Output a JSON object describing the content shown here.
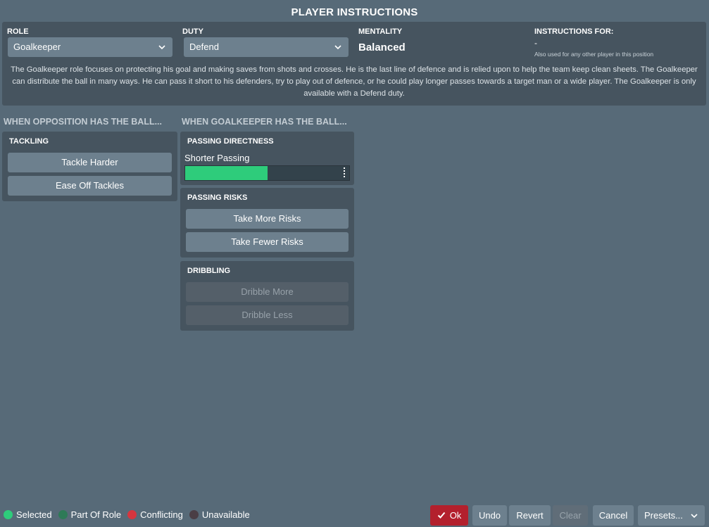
{
  "title": "PLAYER INSTRUCTIONS",
  "role": {
    "label": "ROLE",
    "value": "Goalkeeper"
  },
  "duty": {
    "label": "DUTY",
    "value": "Defend"
  },
  "mentality": {
    "label": "MENTALITY",
    "value": "Balanced"
  },
  "instructions_for": {
    "label": "INSTRUCTIONS FOR:",
    "value": "-",
    "note": "Also used for any other player in this position"
  },
  "description": "The Goalkeeper role focuses on protecting his goal and making saves from shots and crosses. He is the last line of defence and is relied upon to help the team keep clean sheets. The Goalkeeper can distribute the ball in many ways. He can pass it short to his defenders, try to play out of defence, or he could play longer passes towards a target man or a wide player. The Goalkeeper is only available with a Defend duty.",
  "columns": {
    "opposition": "WHEN OPPOSITION HAS THE BALL...",
    "possession": "WHEN GOALKEEPER HAS THE BALL..."
  },
  "tackling": {
    "title": "TACKLING",
    "buttons": [
      "Tackle Harder",
      "Ease Off Tackles"
    ]
  },
  "passing_directness": {
    "title": "PASSING DIRECTNESS",
    "value_label": "Shorter Passing",
    "level": 0.5
  },
  "passing_risks": {
    "title": "PASSING RISKS",
    "buttons": [
      "Take More Risks",
      "Take Fewer Risks"
    ]
  },
  "dribbling": {
    "title": "DRIBBLING",
    "buttons": [
      "Dribble More",
      "Dribble Less"
    ]
  },
  "legend": [
    {
      "label": "Selected",
      "color": "#2ecc7b"
    },
    {
      "label": "Part Of Role",
      "color": "#2e7a57"
    },
    {
      "label": "Conflicting",
      "color": "#d6363f"
    },
    {
      "label": "Unavailable",
      "color": "#4a3e45"
    }
  ],
  "footer": {
    "ok": "Ok",
    "undo": "Undo",
    "revert": "Revert",
    "clear": "Clear",
    "cancel": "Cancel",
    "presets": "Presets..."
  },
  "colors": {
    "accent_green": "#2ecc7b",
    "ok_red": "#b3202d",
    "background": "#576a78",
    "panel": "#46545f"
  }
}
